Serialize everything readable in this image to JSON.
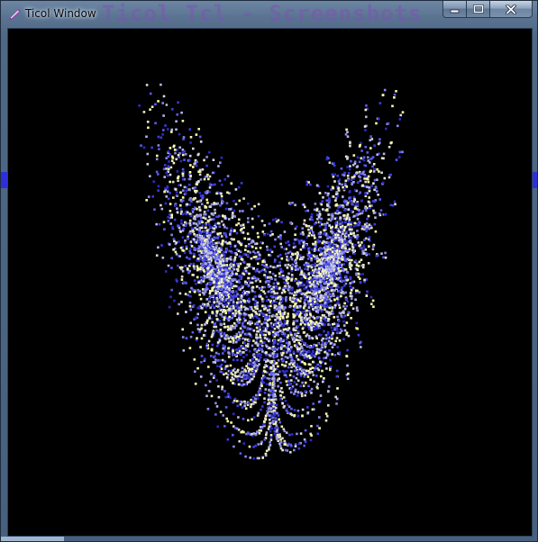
{
  "window": {
    "title": "Ticol Window",
    "background_title": "Ticol Tcl - Screenshots"
  },
  "controls": {
    "minimize_label": "Minimize",
    "maximize_label": "Maximize",
    "close_label": "Close"
  },
  "canvas": {
    "background_color": "#000000",
    "attractor": "lorenz",
    "point_colors": [
      "#2b2bc8",
      "#3c3ce0",
      "#5a5af0",
      "#8888e8",
      "#b4b4e6",
      "#d9d9d9",
      "#f0f0b8",
      "#ffffa6"
    ]
  }
}
